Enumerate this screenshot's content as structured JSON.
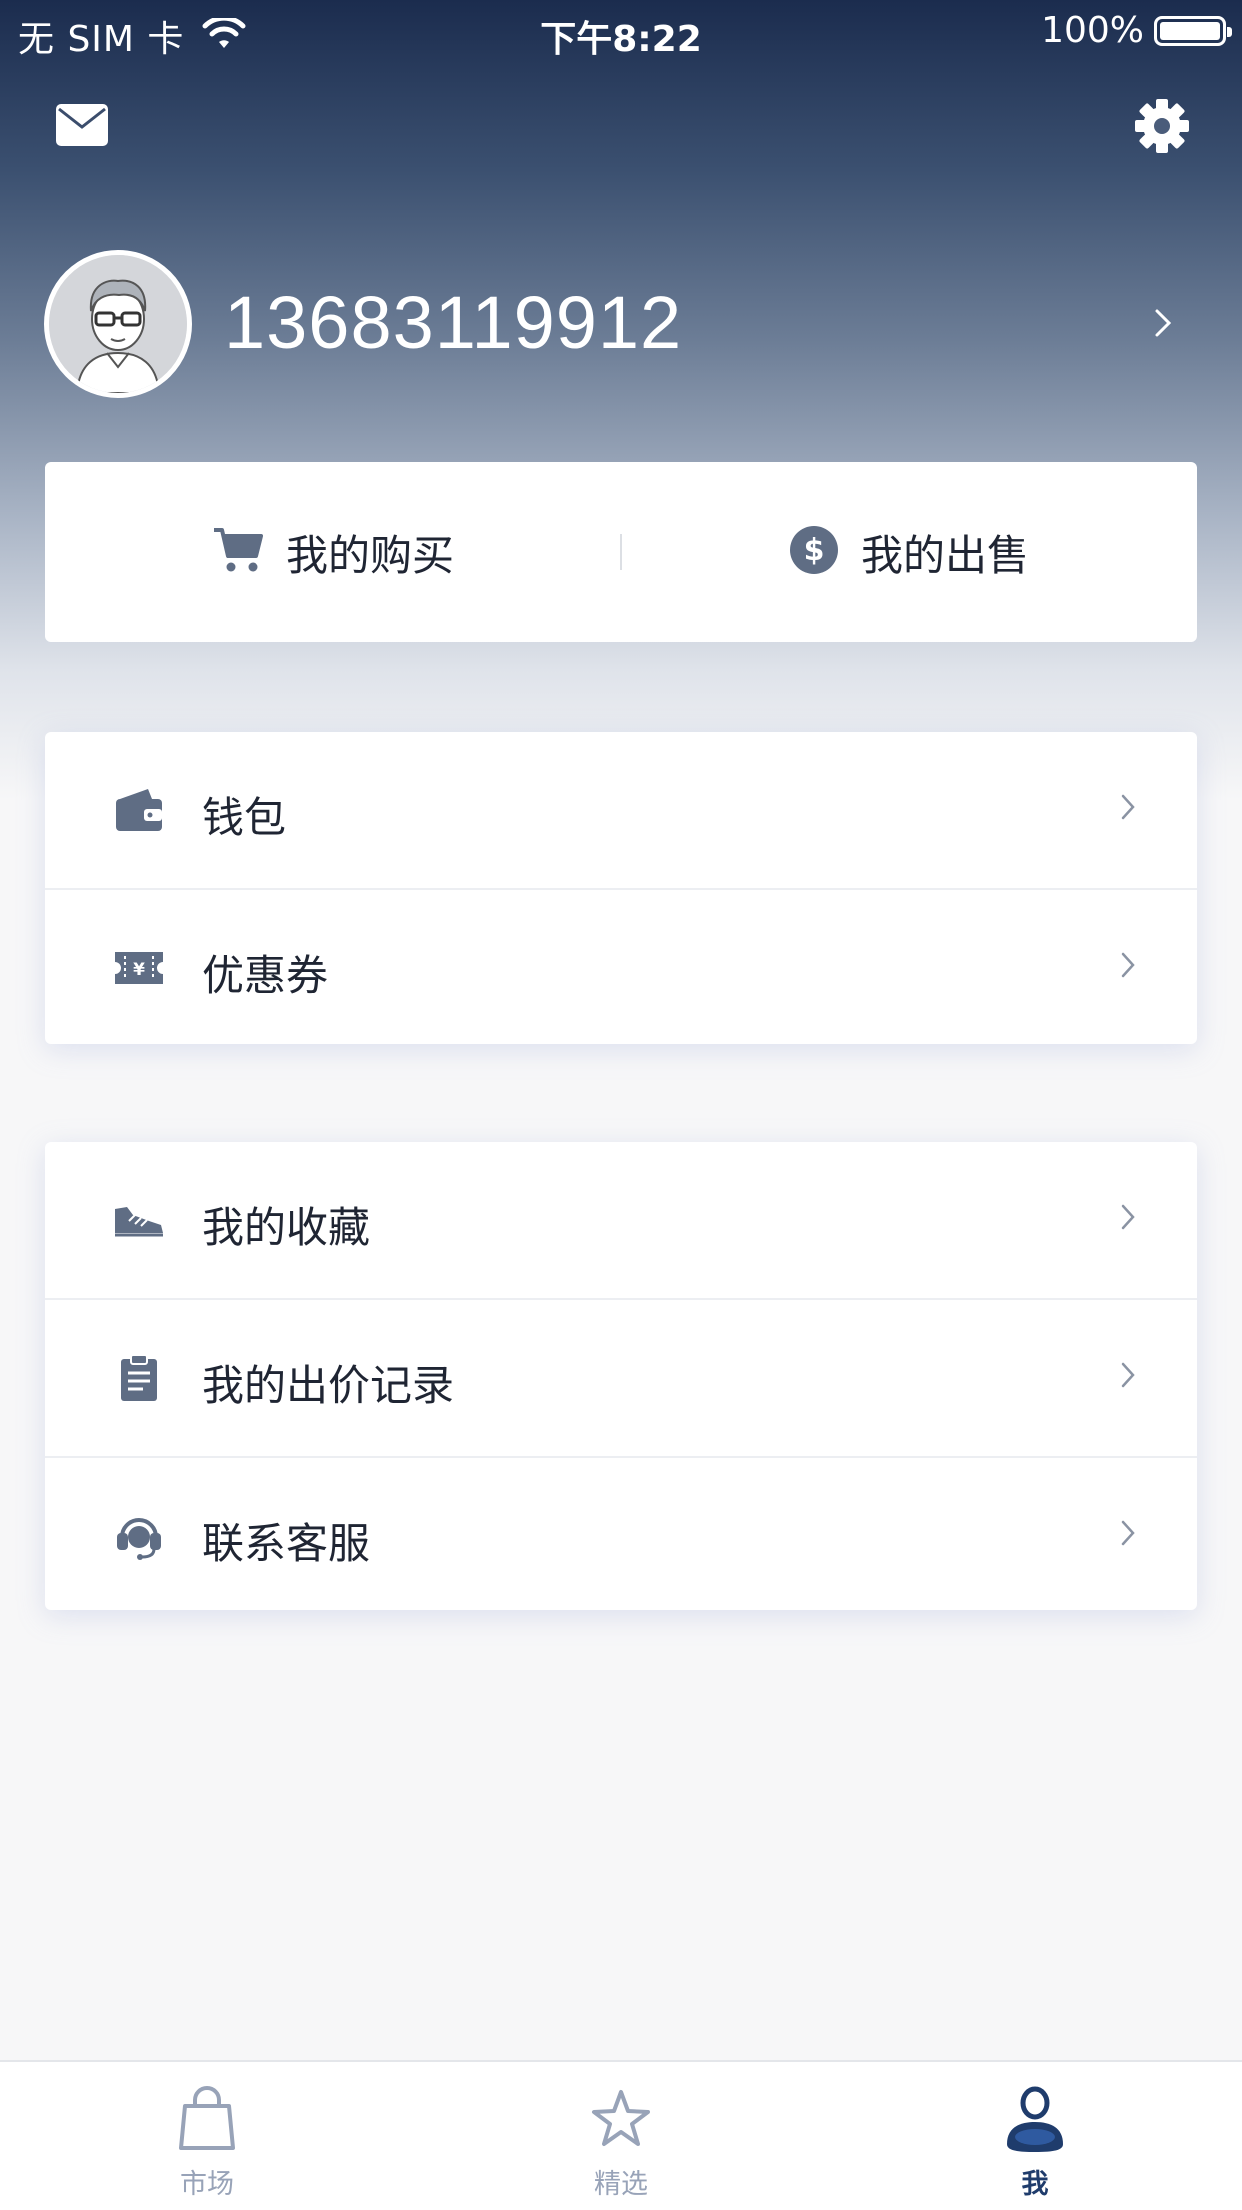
{
  "status_bar": {
    "carrier": "无 SIM 卡",
    "time": "下午8:22",
    "battery": "100%"
  },
  "header": {
    "mail_icon": "envelope-icon",
    "settings_icon": "gear-icon"
  },
  "profile": {
    "username": "13683119912",
    "avatar_icon": "user-avatar-glasses"
  },
  "trade": {
    "buy_label": "我的购买",
    "buy_icon": "cart-icon",
    "sell_label": "我的出售",
    "sell_icon": "dollar-coin-icon"
  },
  "menu_group_1": [
    {
      "label": "钱包",
      "icon": "wallet-icon"
    },
    {
      "label": "优惠券",
      "icon": "coupon-icon"
    }
  ],
  "menu_group_2": [
    {
      "label": "我的收藏",
      "icon": "sneaker-icon"
    },
    {
      "label": "我的出价记录",
      "icon": "clipboard-icon"
    },
    {
      "label": "联系客服",
      "icon": "headset-icon"
    }
  ],
  "tabbar": [
    {
      "label": "市场",
      "icon": "bag-icon",
      "active": false
    },
    {
      "label": "精选",
      "icon": "star-icon",
      "active": false
    },
    {
      "label": "我",
      "icon": "person-icon",
      "active": true
    }
  ],
  "colors": {
    "icon_gray": "#5f6d84",
    "text_dark": "#1f2533",
    "active_tab": "#1f3c6c",
    "inactive_tab": "#98a3b8",
    "header_top": "#1b2c4e"
  }
}
